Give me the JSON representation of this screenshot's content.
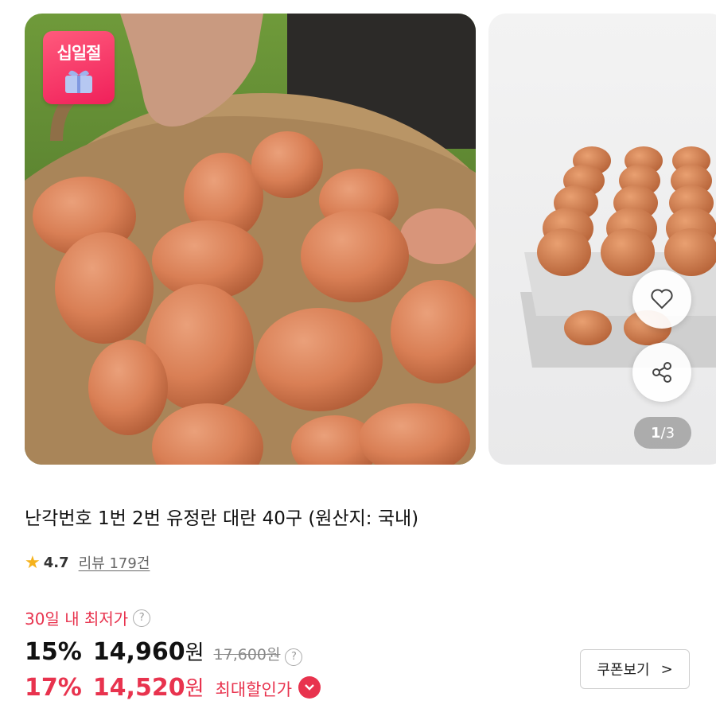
{
  "badge": {
    "text": "십일절"
  },
  "gallery": {
    "current": "1",
    "total": "/3"
  },
  "product": {
    "title": "난각번호 1번 2번 유정란 대란 40구 (원산지: 국내)",
    "rating": "4.7",
    "reviews": "리뷰 179건"
  },
  "price": {
    "lowest_label": "30일 내 최저가",
    "help_glyph": "?",
    "discount_rate": "15%",
    "discount_price": "14,960",
    "unit": "원",
    "original_price": "17,600원",
    "max_rate": "17%",
    "max_price": "14,520",
    "max_label": "최대할인가"
  },
  "coupon": {
    "label": "쿠폰보기",
    "arrow": ">"
  },
  "colors": {
    "accent": "#e8334e",
    "star": "#f5b21c"
  }
}
